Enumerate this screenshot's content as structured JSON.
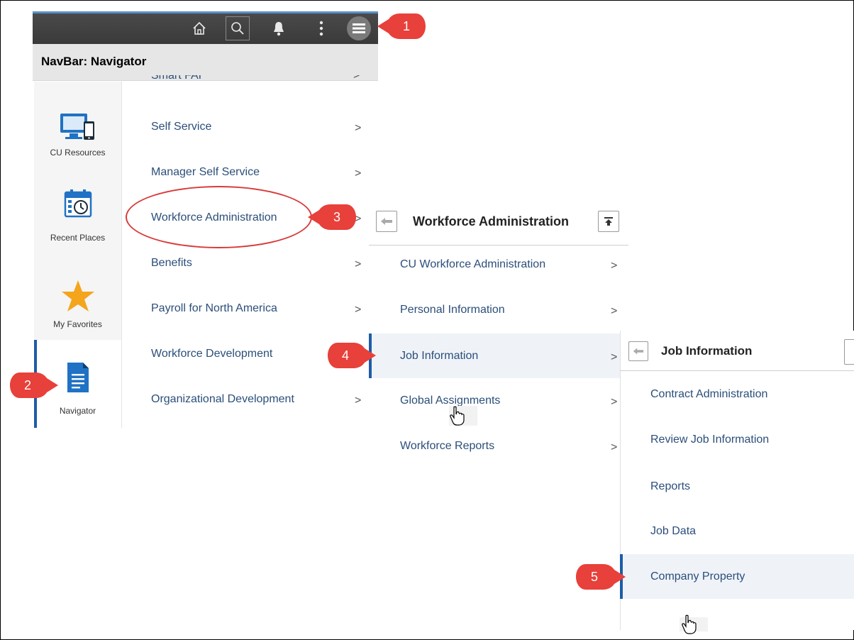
{
  "navbar": {
    "title": "NavBar: Navigator",
    "icons": [
      "home-icon",
      "search-icon",
      "bell-icon",
      "kebab-menu-icon",
      "hamburger-menu-icon"
    ]
  },
  "rail": {
    "items": [
      {
        "label": "CU Resources",
        "icon": "monitor-phone-icon"
      },
      {
        "label": "Recent Places",
        "icon": "calendar-clock-icon"
      },
      {
        "label": "My Favorites",
        "icon": "star-icon"
      },
      {
        "label": "Navigator",
        "icon": "document-icon"
      }
    ]
  },
  "menu": {
    "partial_top": "Smart FAI",
    "items": [
      {
        "label": "Self Service"
      },
      {
        "label": "Manager Self Service"
      },
      {
        "label": "Workforce Administration"
      },
      {
        "label": "Benefits"
      },
      {
        "label": "Payroll for North America"
      },
      {
        "label": "Workforce Development"
      },
      {
        "label": "Organizational Development"
      }
    ]
  },
  "workforce_panel": {
    "title": "Workforce Administration",
    "items": [
      {
        "label": "CU Workforce Administration"
      },
      {
        "label": "Personal Information"
      },
      {
        "label": "Job Information"
      },
      {
        "label": "Global Assignments"
      },
      {
        "label": "Workforce Reports"
      }
    ]
  },
  "job_panel": {
    "title": "Job Information",
    "items": [
      {
        "label": "Contract Administration"
      },
      {
        "label": "Review Job Information"
      },
      {
        "label": "Reports"
      },
      {
        "label": "Job Data"
      },
      {
        "label": "Company Property"
      }
    ]
  },
  "callouts": [
    "1",
    "2",
    "3",
    "4",
    "5"
  ],
  "colors": {
    "callout_red": "#e8403a",
    "highlight_blue": "#1f5ca8",
    "link_text": "#2b4e7a",
    "star": "#f4a51c"
  }
}
